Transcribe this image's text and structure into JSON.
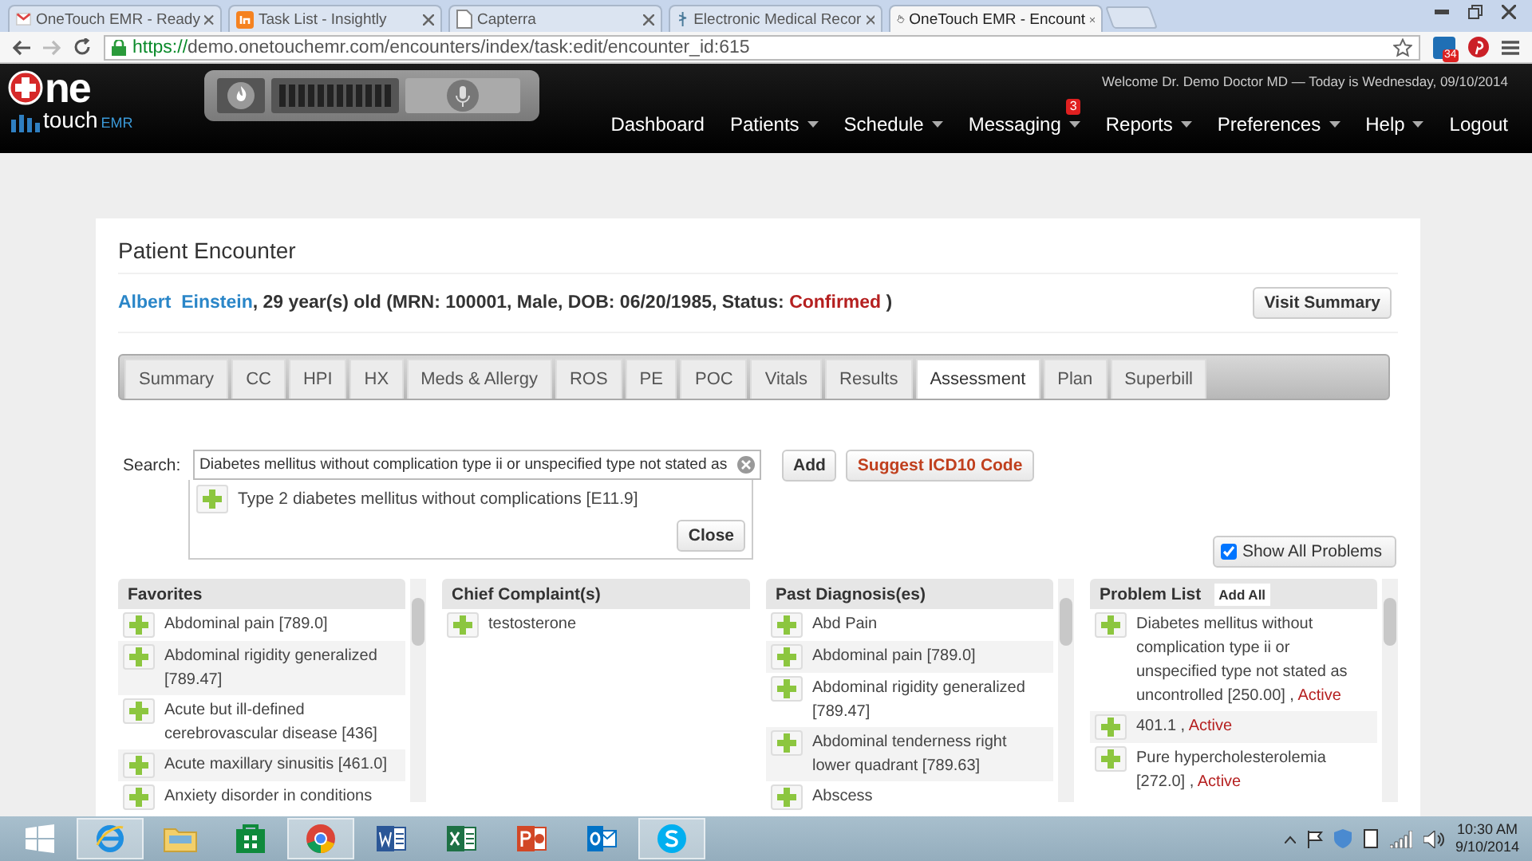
{
  "browser": {
    "tabs": [
      {
        "kind": "mail",
        "title": "OneTouch EMR - Ready",
        "selected": false
      },
      {
        "kind": "tile",
        "title": "Task List - Insightly",
        "selected": false
      },
      {
        "kind": "page",
        "title": "Capterra",
        "selected": false
      },
      {
        "kind": "staff",
        "title": "Electronic Medical Recor",
        "selected": false
      },
      {
        "kind": "hand",
        "title": "OneTouch EMR - Encount",
        "selected": true
      }
    ],
    "address": {
      "scheme": "https://",
      "rest": "demo.onetouchemr.com/encounters/index/task:edit/encounter_id:615"
    },
    "extension_badge": "34"
  },
  "header": {
    "logo": {
      "mark": "ne",
      "word": "touch",
      "suffix": "EMR"
    },
    "welcome": "Welcome Dr. Demo Doctor MD — Today is Wednesday, 09/10/2014",
    "nav": [
      {
        "label": "Dashboard",
        "dropdown": false
      },
      {
        "label": "Patients",
        "dropdown": true
      },
      {
        "label": "Schedule",
        "dropdown": true
      },
      {
        "label": "Messaging",
        "dropdown": true,
        "badge": "3"
      },
      {
        "label": "Reports",
        "dropdown": true
      },
      {
        "label": "Preferences",
        "dropdown": true
      },
      {
        "label": "Help",
        "dropdown": true
      },
      {
        "label": "Logout",
        "dropdown": false
      }
    ]
  },
  "encounter": {
    "title": "Patient Encounter",
    "patient": {
      "name": "Albert  Einstein",
      "details": ", 29 year(s) old (MRN: 100001, Male, DOB: 06/20/1985, Status: ",
      "status": "Confirmed",
      "end": ")"
    },
    "visit_summary_button": "Visit Summary",
    "tabs": [
      {
        "label": "Summary",
        "selected": false
      },
      {
        "label": "CC",
        "selected": false
      },
      {
        "label": "HPI",
        "selected": false
      },
      {
        "label": "HX",
        "selected": false
      },
      {
        "label": "Meds & Allergy",
        "selected": false
      },
      {
        "label": "ROS",
        "selected": false
      },
      {
        "label": "PE",
        "selected": false
      },
      {
        "label": "POC",
        "selected": false
      },
      {
        "label": "Vitals",
        "selected": false
      },
      {
        "label": "Results",
        "selected": false
      },
      {
        "label": "Assessment",
        "selected": true
      },
      {
        "label": "Plan",
        "selected": false
      },
      {
        "label": "Superbill",
        "selected": false
      }
    ],
    "search": {
      "label": "Search:",
      "value": "Diabetes mellitus without complication type ii or unspecified type not stated as",
      "add_button": "Add",
      "suggest_button": "Suggest ICD10 Code",
      "results": [
        {
          "text": "Type 2 diabetes mellitus without complications [E11.9]"
        }
      ],
      "close_button": "Close"
    },
    "show_all_problems": {
      "label": "Show All Problems",
      "checked": true
    },
    "panels": [
      {
        "title": "Favorites",
        "scrollbar": true,
        "items": [
          {
            "text": "Abdominal pain [789.0]"
          },
          {
            "text": "Abdominal rigidity generalized [789.47]"
          },
          {
            "text": "Acute but ill-defined cerebrovascular disease [436]"
          },
          {
            "text": "Acute maxillary sinusitis [461.0]"
          },
          {
            "text": "Anxiety disorder in conditions"
          }
        ]
      },
      {
        "title": "Chief Complaint(s)",
        "scrollbar": false,
        "items": [
          {
            "text": "testosterone"
          }
        ]
      },
      {
        "title": "Past Diagnosis(es)",
        "scrollbar": true,
        "items": [
          {
            "text": "Abd Pain"
          },
          {
            "text": "Abdominal pain [789.0]"
          },
          {
            "text": "Abdominal rigidity generalized [789.47]"
          },
          {
            "text": "Abdominal tenderness right lower quadrant [789.63]"
          },
          {
            "text": "Abscess"
          }
        ]
      },
      {
        "title": "Problem List",
        "action": "Add All",
        "scrollbar": true,
        "items": [
          {
            "text": "Diabetes mellitus without complication type ii or unspecified type not stated as uncontrolled [250.00] ,",
            "status": "Active"
          },
          {
            "text": "401.1 ,",
            "status": "Active"
          },
          {
            "text": "Pure hypercholesterolemia [272.0] ,",
            "status": "Active"
          }
        ]
      }
    ]
  },
  "taskbar": {
    "apps": [
      {
        "kind": "start",
        "running": false
      },
      {
        "kind": "ie",
        "running": true
      },
      {
        "kind": "explorer",
        "running": false
      },
      {
        "kind": "store",
        "running": false
      },
      {
        "kind": "chrome",
        "running": true
      },
      {
        "kind": "word",
        "running": false
      },
      {
        "kind": "excel",
        "running": false
      },
      {
        "kind": "powerpoint",
        "running": false
      },
      {
        "kind": "outlook",
        "running": false
      },
      {
        "kind": "skype",
        "running": true
      }
    ],
    "clock": {
      "time": "10:30 AM",
      "date": "9/10/2014"
    }
  }
}
